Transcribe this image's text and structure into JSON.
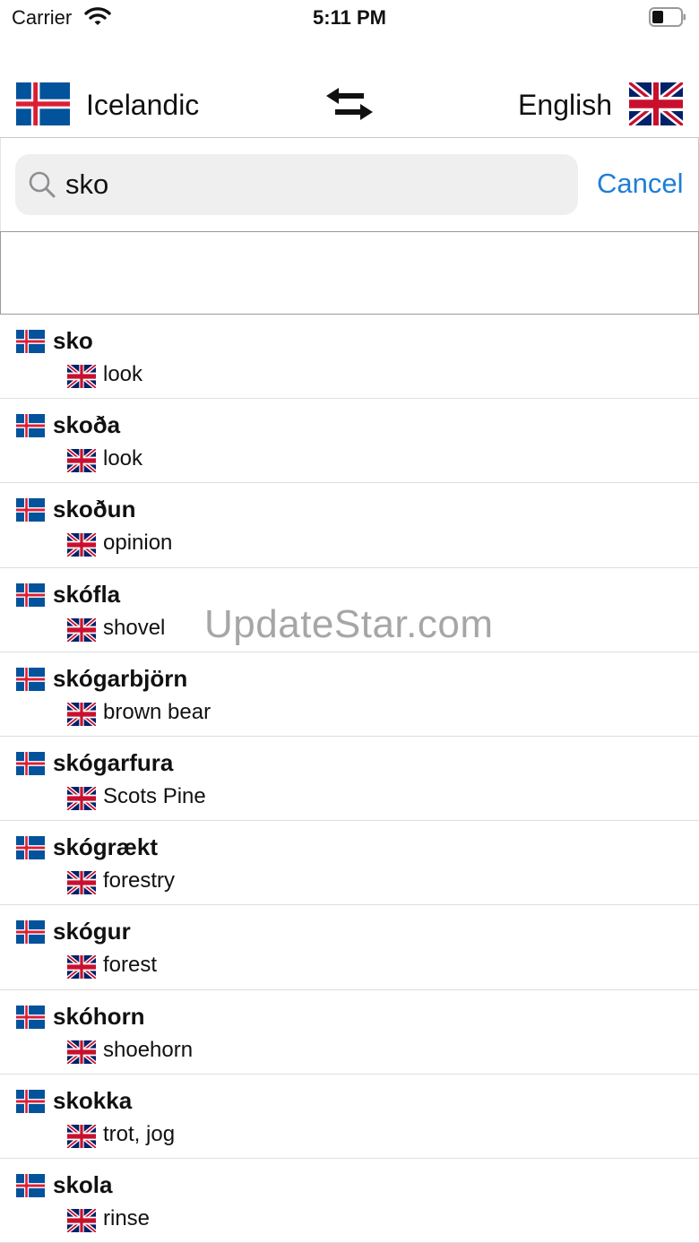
{
  "status_bar": {
    "carrier": "Carrier",
    "time": "5:11 PM"
  },
  "header": {
    "source_language": "Icelandic",
    "target_language": "English",
    "source_flag_icon": "iceland-flag-icon",
    "target_flag_icon": "uk-flag-icon",
    "swap_icon": "swap-arrows-icon"
  },
  "search": {
    "query": "sko",
    "cancel_label": "Cancel"
  },
  "colors": {
    "accent": "#1f7ed6",
    "search_bg": "#efefef",
    "iceland_blue": "#02529c",
    "iceland_red": "#dc1e35",
    "uk_blue": "#012169",
    "uk_red": "#c8102e"
  },
  "results": [
    {
      "word": "sko",
      "translation": "look"
    },
    {
      "word": "skoða",
      "translation": "look"
    },
    {
      "word": "skoðun",
      "translation": "opinion"
    },
    {
      "word": "skófla",
      "translation": "shovel"
    },
    {
      "word": "skógarbjörn",
      "translation": "brown bear"
    },
    {
      "word": "skógarfura",
      "translation": "Scots Pine"
    },
    {
      "word": "skógrækt",
      "translation": "forestry"
    },
    {
      "word": "skógur",
      "translation": "forest"
    },
    {
      "word": "skóhorn",
      "translation": "shoehorn"
    },
    {
      "word": "skokka",
      "translation": "trot, jog"
    },
    {
      "word": "skola",
      "translation": "rinse"
    }
  ],
  "watermark": "UpdateStar.com"
}
